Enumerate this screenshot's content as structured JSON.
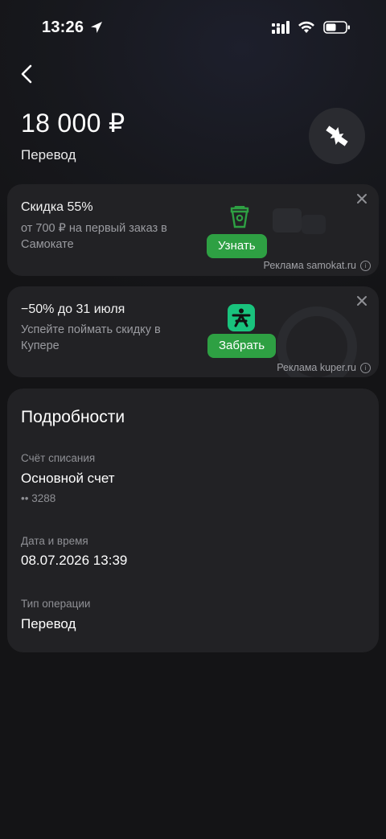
{
  "status_bar": {
    "time": "13:26"
  },
  "header": {
    "amount": "18 000 ₽",
    "subtitle": "Перевод"
  },
  "ads": [
    {
      "title": "Скидка 55%",
      "description": "от 700 ₽ на первый заказ в Самокате",
      "button": "Узнать",
      "reference": "Реклама samokat.ru",
      "icon": "samokat-cup-icon",
      "accent": "#2ea043"
    },
    {
      "title": "−50% до 31 июля",
      "description": "Успейте поймать скидку в Купере",
      "button": "Забрать",
      "reference": "Реклама kuper.ru",
      "icon": "kuper-logo-icon",
      "accent": "#2ea043"
    }
  ],
  "details": {
    "heading": "Подробности",
    "account_label": "Счёт списания",
    "account_value": "Основной счет",
    "account_number": "•• 3288",
    "date_label": "Дата и время",
    "date_value": "08.07.2026 13:39",
    "type_label": "Тип операции",
    "type_value": "Перевод"
  }
}
